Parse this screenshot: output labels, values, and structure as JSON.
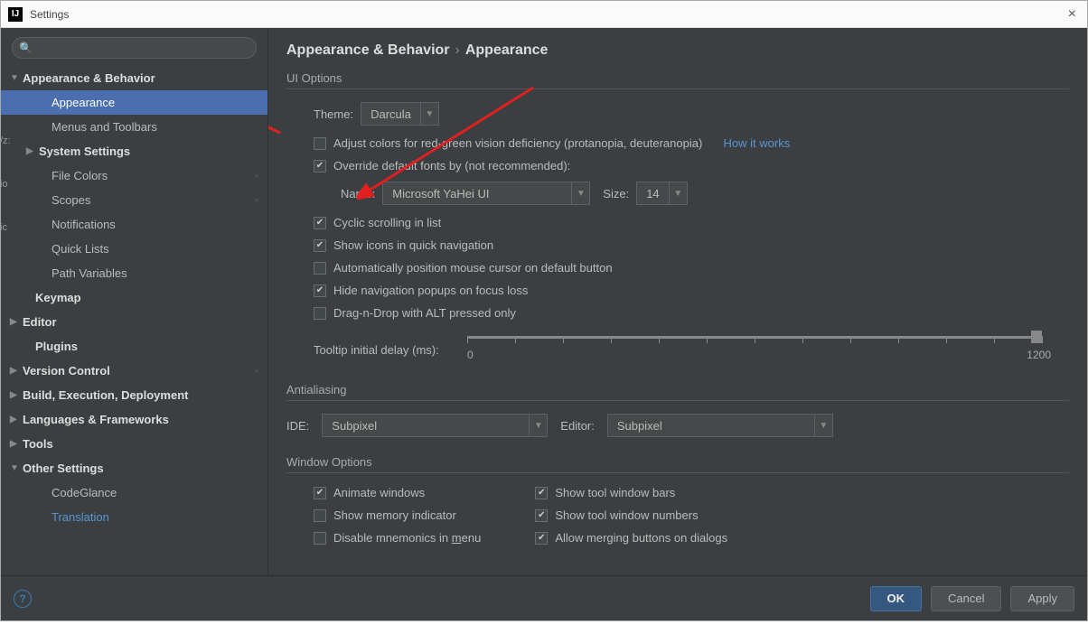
{
  "window": {
    "title": "Settings"
  },
  "search": {
    "placeholder": ""
  },
  "tree": {
    "appearance_behavior": "Appearance & Behavior",
    "appearance": "Appearance",
    "menus_toolbars": "Menus and Toolbars",
    "system_settings": "System Settings",
    "file_colors": "File Colors",
    "scopes": "Scopes",
    "notifications": "Notifications",
    "quick_lists": "Quick Lists",
    "path_variables": "Path Variables",
    "keymap": "Keymap",
    "editor": "Editor",
    "plugins": "Plugins",
    "version_control": "Version Control",
    "build": "Build, Execution, Deployment",
    "languages": "Languages & Frameworks",
    "tools": "Tools",
    "other_settings": "Other Settings",
    "codeglance": "CodeGlance",
    "translation": "Translation"
  },
  "breadcrumb": {
    "parent": "Appearance & Behavior",
    "current": "Appearance"
  },
  "ui_options": {
    "title": "UI Options",
    "theme_label": "Theme:",
    "theme_value": "Darcula",
    "adjust_colors": "Adjust colors for red-green vision deficiency (protanopia, deuteranopia)",
    "how_it_works": "How it works",
    "override_fonts": "Override default fonts by (not recommended):",
    "name_label": "Name:",
    "font_value": "Microsoft YaHei UI",
    "size_label": "Size:",
    "size_value": "14",
    "cyclic": "Cyclic scrolling in list",
    "show_icons": "Show icons in quick navigation",
    "auto_position": "Automatically position mouse cursor on default button",
    "hide_nav": "Hide navigation popups on focus loss",
    "dnd_alt": "Drag-n-Drop with ALT pressed only",
    "tooltip_label": "Tooltip initial delay (ms):",
    "tooltip_min": "0",
    "tooltip_max": "1200"
  },
  "antialiasing": {
    "title": "Antialiasing",
    "ide_label": "IDE:",
    "ide_value": "Subpixel",
    "editor_label": "Editor:",
    "editor_value": "Subpixel"
  },
  "window_options": {
    "title": "Window Options",
    "animate": "Animate windows",
    "memory": "Show memory indicator",
    "mnemonics_pre": "Disable mnemonics in ",
    "mnemonics_u": "m",
    "mnemonics_post": "enu",
    "bars": "Show tool window bars",
    "numbers": "Show tool window numbers",
    "merging": "Allow merging buttons on dialogs"
  },
  "footer": {
    "ok": "OK",
    "cancel": "Cancel",
    "apply": "Apply"
  }
}
